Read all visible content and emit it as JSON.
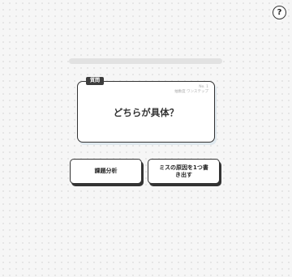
{
  "header": {
    "help_label": "?"
  },
  "progress": {
    "fraction": 0
  },
  "question_card": {
    "badge": "質問",
    "meta_line1": "No. 1",
    "meta_line2": "抽象度 ワンステップ",
    "question": "どちらが具体？"
  },
  "answers": [
    {
      "label": "課題分析"
    },
    {
      "label": "ミスの原因を1つ書き出す"
    }
  ]
}
